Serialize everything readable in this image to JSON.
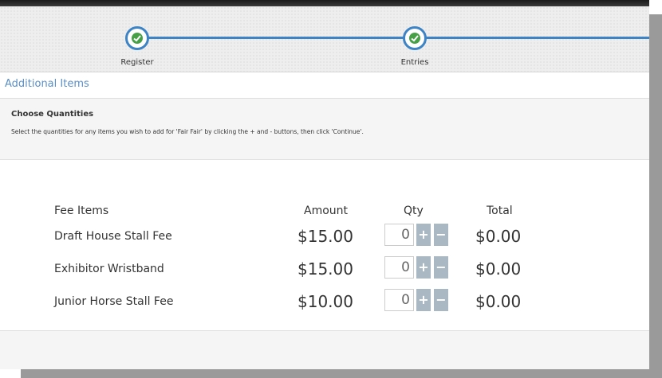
{
  "stepper": {
    "steps": [
      {
        "label": "Register",
        "status": "complete"
      },
      {
        "label": "Entries",
        "status": "complete"
      }
    ],
    "accent_color": "#3d84c6",
    "check_color": "#46a046"
  },
  "section": {
    "title": "Additional Items"
  },
  "choose": {
    "title": "Choose Quantities",
    "description": "Select the quantities for any items you wish to add for 'Fair Fair' by clicking the + and - buttons, then click 'Continue'."
  },
  "fees": {
    "headers": {
      "item": "Fee Items",
      "amount": "Amount",
      "qty": "Qty",
      "total": "Total"
    },
    "rows": [
      {
        "name": "Draft House Stall Fee",
        "amount": "$15.00",
        "qty": "0",
        "plus": "+",
        "minus": "−",
        "total": "$0.00"
      },
      {
        "name": "Exhibitor Wristband",
        "amount": "$15.00",
        "qty": "0",
        "plus": "+",
        "minus": "−",
        "total": "$0.00"
      },
      {
        "name": "Junior Horse Stall Fee",
        "amount": "$10.00",
        "qty": "0",
        "plus": "+",
        "minus": "−",
        "total": "$0.00"
      }
    ]
  }
}
